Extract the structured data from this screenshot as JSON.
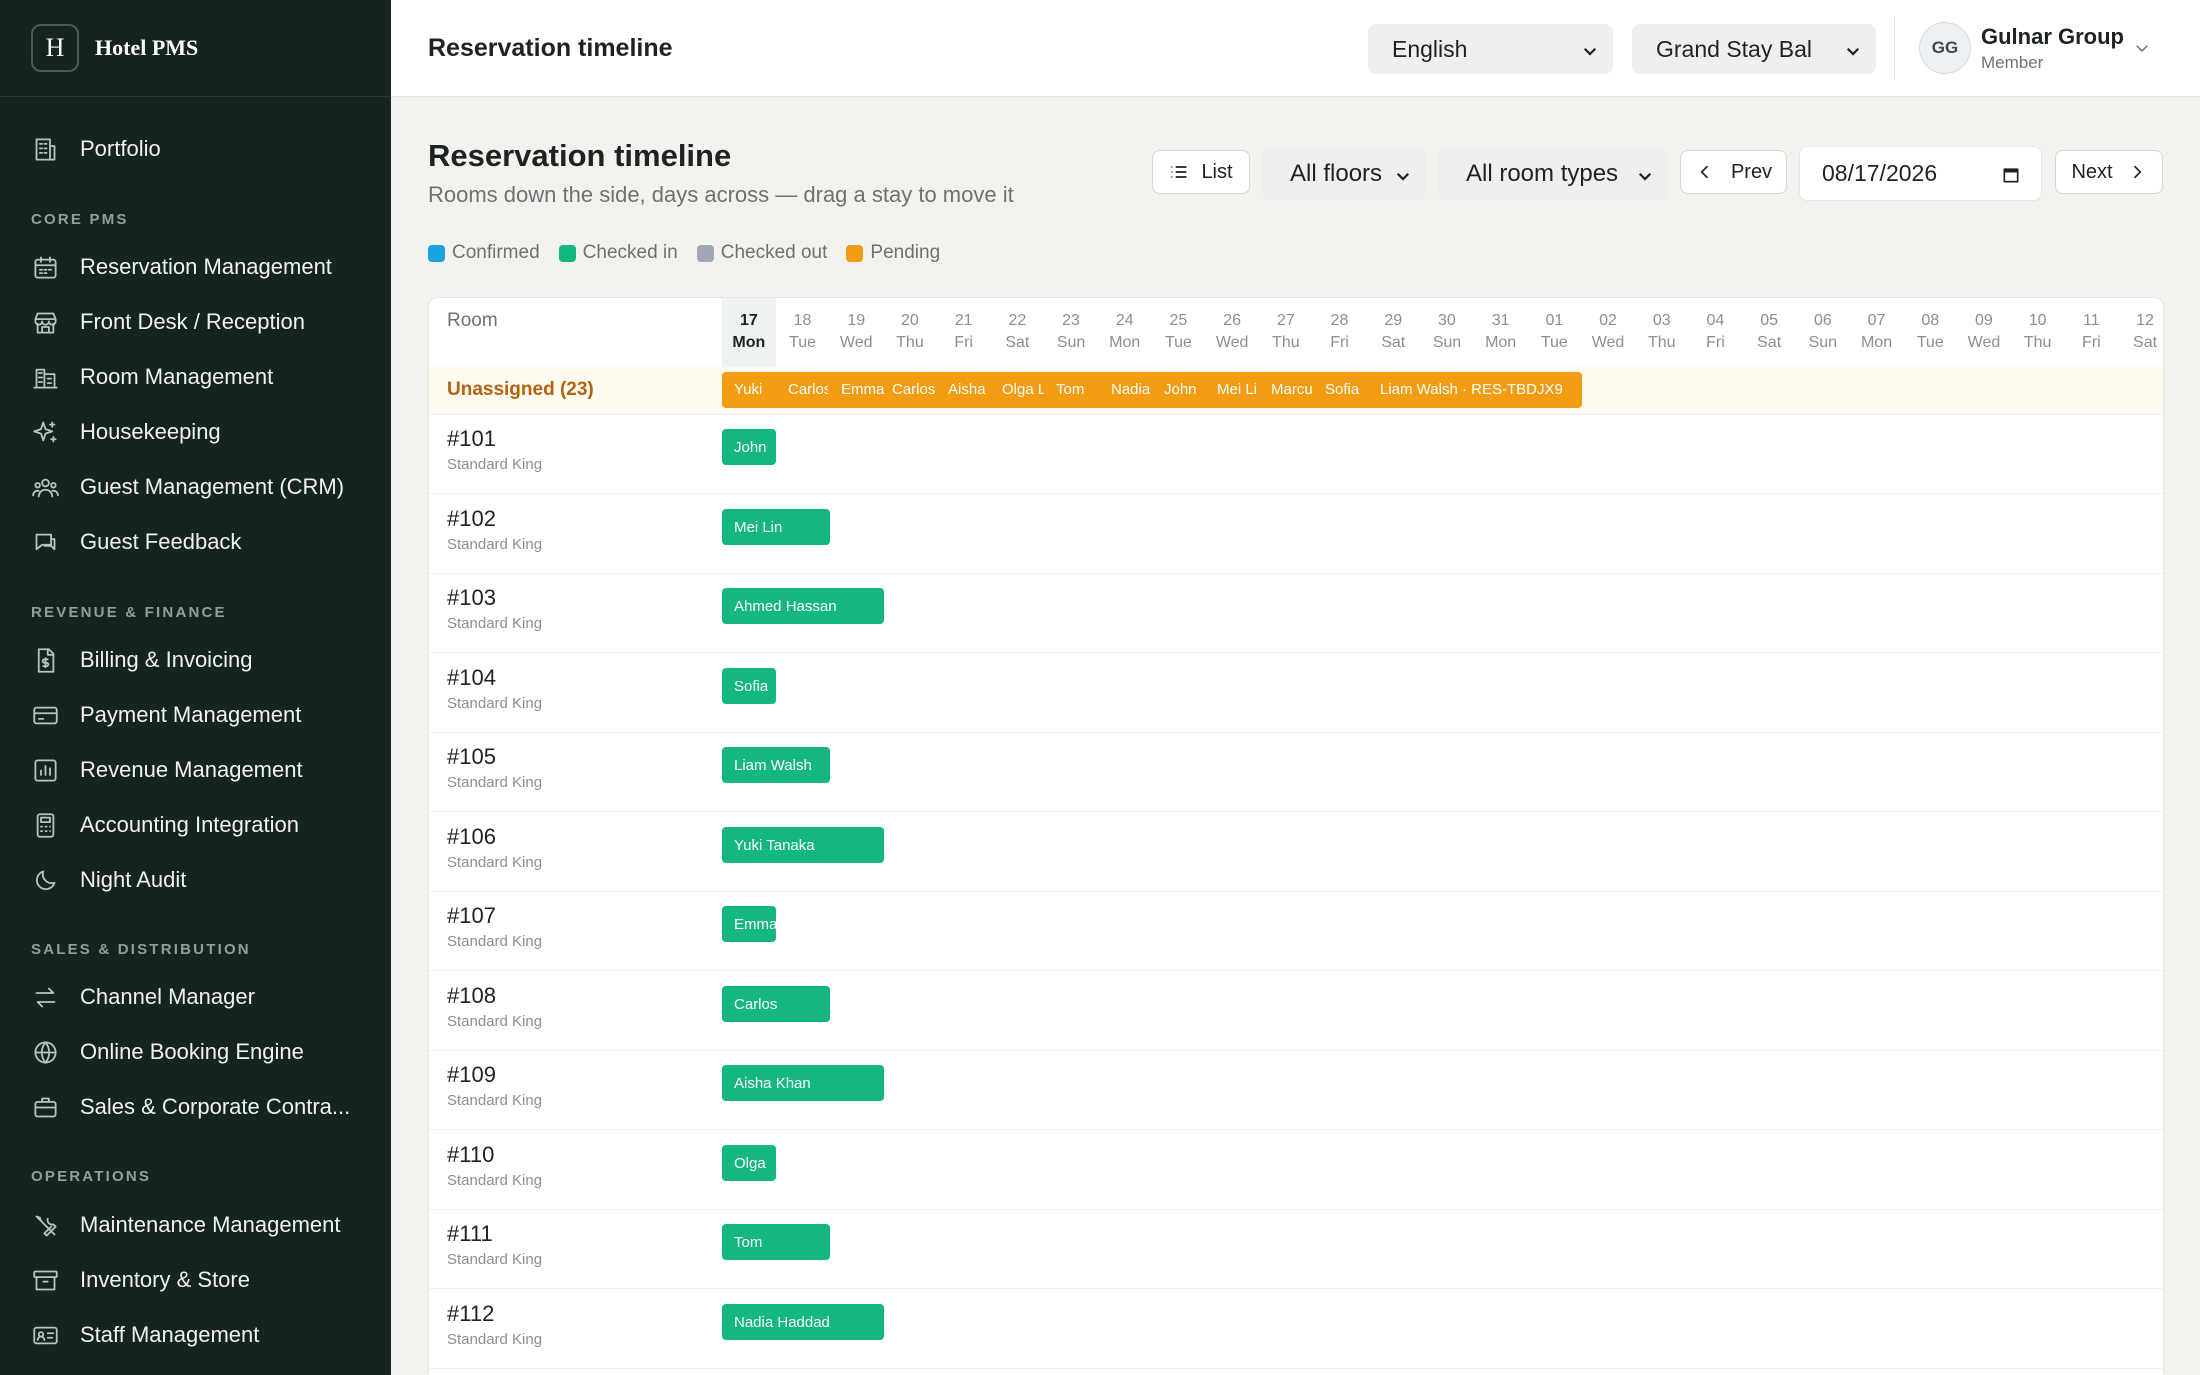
{
  "brand": {
    "logo": "H",
    "name": "Hotel PMS"
  },
  "nav": {
    "portfolio": "Portfolio",
    "sections": {
      "core": "CORE PMS",
      "revenue": "REVENUE & FINANCE",
      "sales": "SALES & DISTRIBUTION",
      "ops": "OPERATIONS"
    },
    "items": {
      "reservation": "Reservation Management",
      "frontdesk": "Front Desk / Reception",
      "room": "Room Management",
      "housekeeping": "Housekeeping",
      "crm": "Guest Management (CRM)",
      "feedback": "Guest Feedback",
      "billing": "Billing & Invoicing",
      "payment": "Payment Management",
      "revenue": "Revenue Management",
      "accounting": "Accounting Integration",
      "nightaudit": "Night Audit",
      "channel": "Channel Manager",
      "booking": "Online Booking Engine",
      "sales": "Sales & Corporate Contra...",
      "maintenance": "Maintenance Management",
      "inventory": "Inventory & Store",
      "staff": "Staff Management"
    }
  },
  "topbar": {
    "title": "Reservation timeline",
    "language": "English",
    "property": "Grand Stay Bal",
    "user": {
      "initials": "GG",
      "name": "Gulnar Group",
      "role": "Member"
    }
  },
  "page": {
    "title": "Reservation timeline",
    "subtitle": "Rooms down the side, days across — drag a stay to move it"
  },
  "toolbar": {
    "list": "List",
    "floors": "All floors",
    "room_types": "All room types",
    "prev": "Prev",
    "date": "08/17/2026",
    "next": "Next"
  },
  "legend": [
    {
      "label": "Confirmed",
      "color": "#1aa3e0"
    },
    {
      "label": "Checked in",
      "color": "#14b87f"
    },
    {
      "label": "Checked out",
      "color": "#a1a8b5"
    },
    {
      "label": "Pending",
      "color": "#f39c12"
    }
  ],
  "timeline": {
    "room_header": "Room",
    "days": [
      {
        "d": "17",
        "w": "Mon"
      },
      {
        "d": "18",
        "w": "Tue"
      },
      {
        "d": "19",
        "w": "Wed"
      },
      {
        "d": "20",
        "w": "Thu"
      },
      {
        "d": "21",
        "w": "Fri"
      },
      {
        "d": "22",
        "w": "Sat"
      },
      {
        "d": "23",
        "w": "Sun"
      },
      {
        "d": "24",
        "w": "Mon"
      },
      {
        "d": "25",
        "w": "Tue"
      },
      {
        "d": "26",
        "w": "Wed"
      },
      {
        "d": "27",
        "w": "Thu"
      },
      {
        "d": "28",
        "w": "Fri"
      },
      {
        "d": "29",
        "w": "Sat"
      },
      {
        "d": "30",
        "w": "Sun"
      },
      {
        "d": "31",
        "w": "Mon"
      },
      {
        "d": "01",
        "w": "Tue"
      },
      {
        "d": "02",
        "w": "Wed"
      },
      {
        "d": "03",
        "w": "Thu"
      },
      {
        "d": "04",
        "w": "Fri"
      },
      {
        "d": "05",
        "w": "Sat"
      },
      {
        "d": "06",
        "w": "Sun"
      },
      {
        "d": "07",
        "w": "Mon"
      },
      {
        "d": "08",
        "w": "Tue"
      },
      {
        "d": "09",
        "w": "Wed"
      },
      {
        "d": "10",
        "w": "Thu"
      },
      {
        "d": "11",
        "w": "Fri"
      },
      {
        "d": "12",
        "w": "Sat"
      }
    ],
    "unassigned_label": "Unassigned (23)",
    "unassigned": [
      "Yuki",
      "Carlos",
      "Emma",
      "Carlos",
      "Aisha",
      "Olga L",
      "Tom",
      "Nadia",
      "John",
      "Mei Li",
      "Marcus",
      "Sofia",
      "Liam Walsh · RES-TBDJX9"
    ],
    "rooms": [
      {
        "num": "#101",
        "type": "Standard King",
        "guest": "John",
        "nights": 1
      },
      {
        "num": "#102",
        "type": "Standard King",
        "guest": "Mei Lin",
        "nights": 2
      },
      {
        "num": "#103",
        "type": "Standard King",
        "guest": "Ahmed Hassan",
        "nights": 3
      },
      {
        "num": "#104",
        "type": "Standard King",
        "guest": "Sofia",
        "nights": 1
      },
      {
        "num": "#105",
        "type": "Standard King",
        "guest": "Liam Walsh",
        "nights": 2
      },
      {
        "num": "#106",
        "type": "Standard King",
        "guest": "Yuki Tanaka",
        "nights": 3
      },
      {
        "num": "#107",
        "type": "Standard King",
        "guest": "Emma",
        "nights": 1
      },
      {
        "num": "#108",
        "type": "Standard King",
        "guest": "Carlos",
        "nights": 2
      },
      {
        "num": "#109",
        "type": "Standard King",
        "guest": "Aisha Khan",
        "nights": 3
      },
      {
        "num": "#110",
        "type": "Standard King",
        "guest": "Olga",
        "nights": 1
      },
      {
        "num": "#111",
        "type": "Standard King",
        "guest": "Tom",
        "nights": 2
      },
      {
        "num": "#112",
        "type": "Standard King",
        "guest": "Nadia Haddad",
        "nights": 3
      }
    ]
  }
}
